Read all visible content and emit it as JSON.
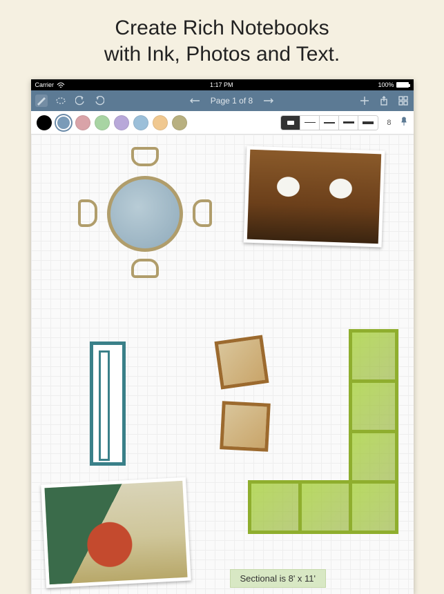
{
  "headline_line1": "Create Rich Notebooks",
  "headline_line2": "with Ink, Photos and Text.",
  "statusbar": {
    "carrier": "Carrier",
    "time": "1:17 PM",
    "battery_pct": "100%"
  },
  "toolbar": {
    "page_indicator": "Page 1 of 8"
  },
  "colorbar": {
    "swatches": [
      {
        "color": "#000000"
      },
      {
        "color": "#7a9bb8",
        "selected": true
      },
      {
        "color": "#d9a3a8"
      },
      {
        "color": "#a8d4a3"
      },
      {
        "color": "#b8a8d9"
      },
      {
        "color": "#9bbfd9"
      },
      {
        "color": "#f0c890"
      },
      {
        "color": "#b8b080"
      }
    ],
    "brush_count": "8"
  },
  "canvas": {
    "note_text": "Sectional is 8' x 11'"
  }
}
